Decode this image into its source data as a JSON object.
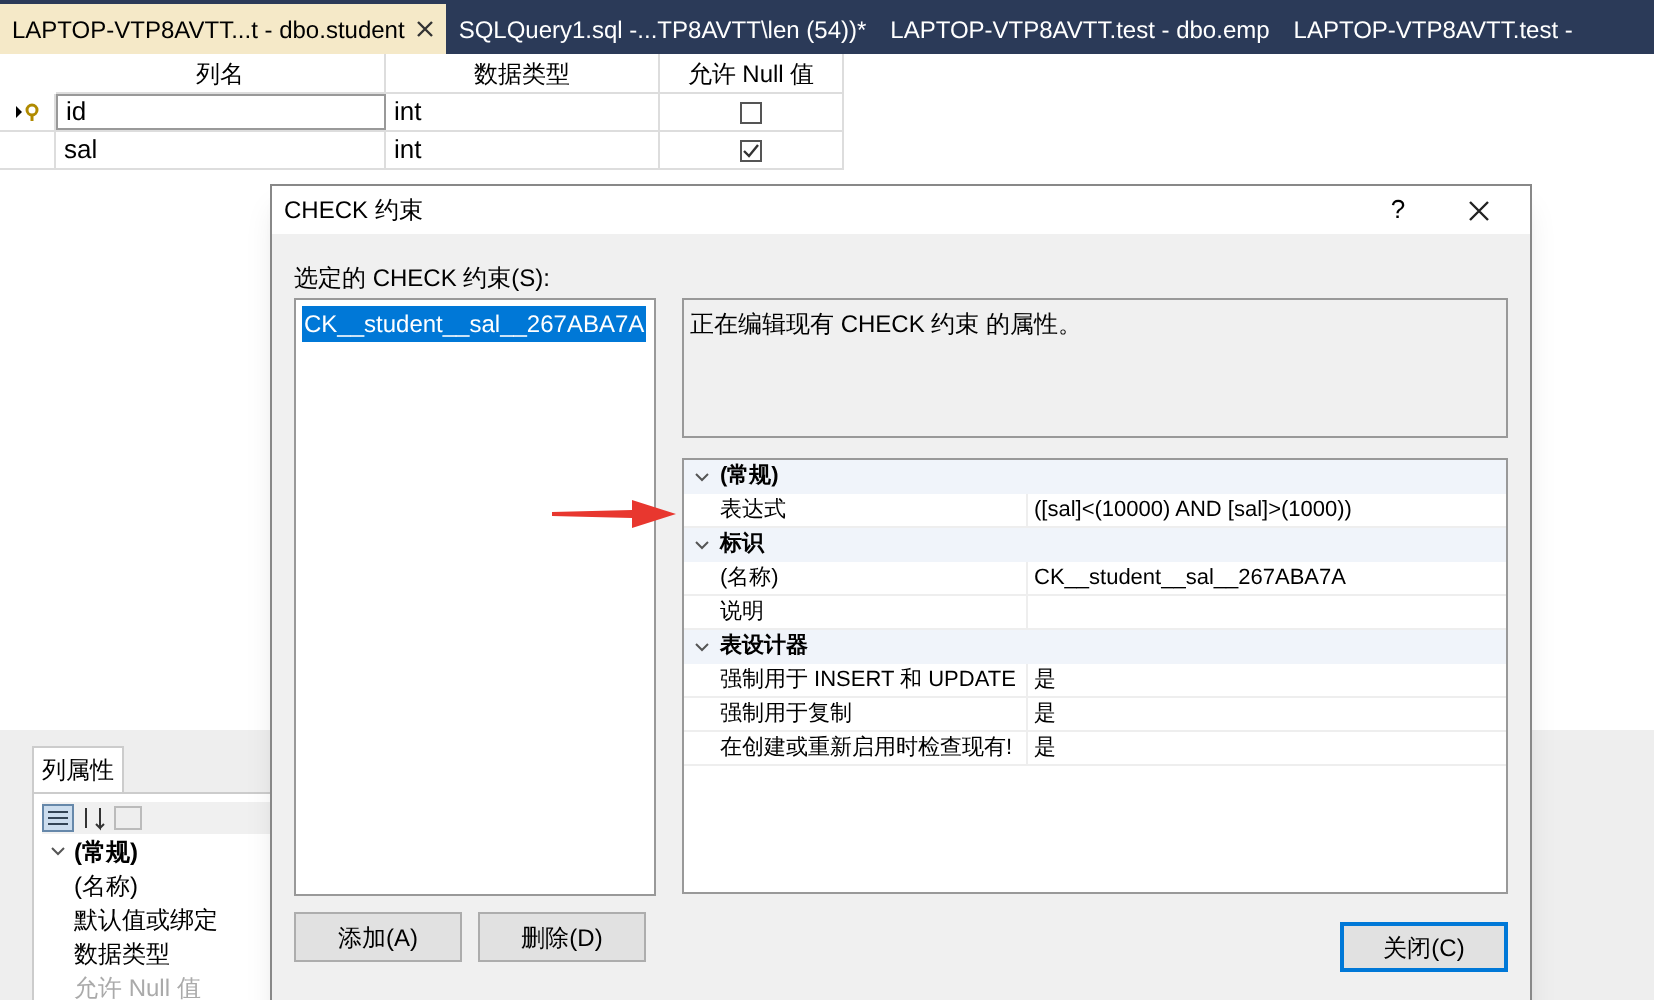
{
  "tabs": [
    {
      "label": "LAPTOP-VTP8AVTT...t - dbo.student",
      "selected": true,
      "closable": true
    },
    {
      "label": "SQLQuery1.sql -...TP8AVTT\\len (54))*",
      "selected": false,
      "closable": false
    },
    {
      "label": "LAPTOP-VTP8AVTT.test - dbo.emp",
      "selected": false,
      "closable": false
    },
    {
      "label": "LAPTOP-VTP8AVTT.test -",
      "selected": false,
      "closable": false
    }
  ],
  "table": {
    "columns": [
      "列名",
      "数据类型",
      "允许 Null 值"
    ],
    "rows": [
      {
        "name": "id",
        "type": "int",
        "allow_null": false,
        "primary_key": true,
        "editing": true
      },
      {
        "name": "sal",
        "type": "int",
        "allow_null": true,
        "primary_key": false,
        "editing": false
      }
    ]
  },
  "column_properties": {
    "tab": "列属性",
    "rows": [
      {
        "label": "(常规)",
        "kind": "category"
      },
      {
        "label": "(名称)",
        "kind": "property"
      },
      {
        "label": "默认值或绑定",
        "kind": "property"
      },
      {
        "label": "数据类型",
        "kind": "property"
      },
      {
        "label": "允许 Null 值",
        "kind": "disabled"
      }
    ]
  },
  "dialog": {
    "title": "CHECK 约束",
    "help": "?",
    "list_label": "选定的 CHECK 约束(S):",
    "constraints": [
      {
        "label": "CK__student__sal__267ABA7A",
        "selected": true
      }
    ],
    "description": "正在编辑现有 CHECK 约束 的属性。",
    "properties": [
      {
        "label": "(常规)",
        "kind": "category",
        "expanded": true
      },
      {
        "label": "表达式",
        "value": "([sal]<(10000) AND [sal]>(1000))",
        "kind": "property"
      },
      {
        "label": "标识",
        "kind": "category",
        "expanded": true
      },
      {
        "label": "(名称)",
        "value": "CK__student__sal__267ABA7A",
        "kind": "property"
      },
      {
        "label": "说明",
        "kind": "property"
      },
      {
        "label": "表设计器",
        "kind": "category",
        "expanded": true
      },
      {
        "label": "强制用于 INSERT 和 UPDATE",
        "value": "是",
        "kind": "property"
      },
      {
        "label": "强制用于复制",
        "value": "是",
        "kind": "property"
      },
      {
        "label": "在创建或重新启用时检查现有!",
        "value": "是",
        "kind": "property"
      }
    ],
    "buttons": [
      "添加(A)",
      "删除(D)"
    ],
    "close_button": "关闭(C)"
  }
}
